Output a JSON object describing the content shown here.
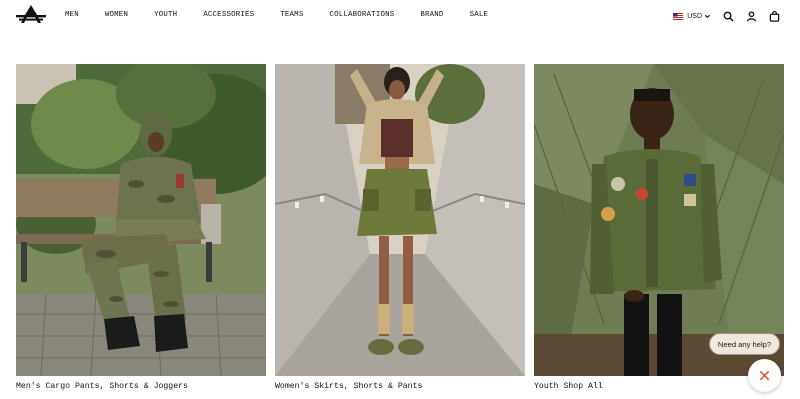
{
  "brand": {
    "logo_icon": "alpha-industries-logo-icon"
  },
  "nav": {
    "items": [
      "MEN",
      "WOMEN",
      "YOUTH",
      "ACCESSORIES",
      "TEAMS",
      "COLLABORATIONS",
      "BRAND",
      "SALE"
    ]
  },
  "header_tools": {
    "currency": "USD",
    "currency_icon": "us-flag-icon",
    "search_icon": "search-icon",
    "account_icon": "user-icon",
    "cart_icon": "shopping-bag-icon"
  },
  "tiles": [
    {
      "caption": "Men's Cargo Pants, Shorts & Joggers"
    },
    {
      "caption": "Women's Skirts, Shorts & Pants"
    },
    {
      "caption": "Youth Shop All"
    }
  ],
  "help": {
    "bubble_text": "Need any help?",
    "close_icon": "close-x-icon"
  },
  "colors": {
    "accent": "#e0502b",
    "text": "#111111",
    "bubble_bg": "#efe7dc"
  }
}
